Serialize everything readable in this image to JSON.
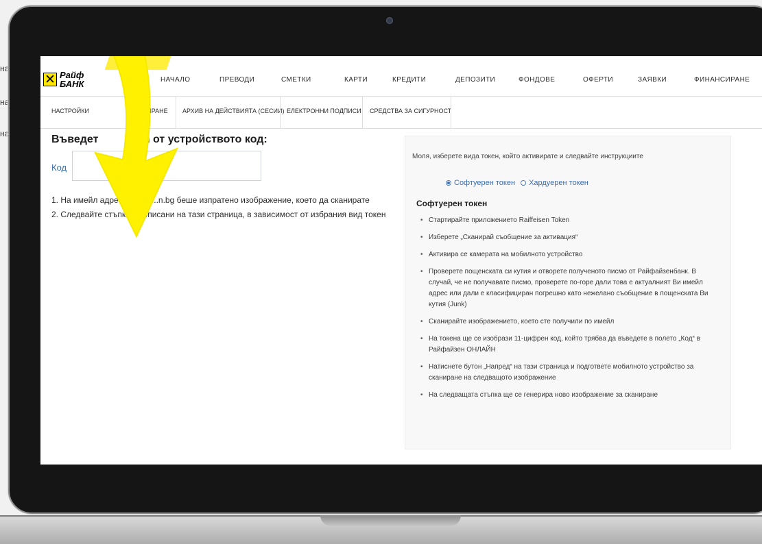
{
  "brand": {
    "line1": "Райф",
    "line2": "БАНК"
  },
  "left_strip": [
    "на",
    "на",
    "на"
  ],
  "nav": {
    "items": [
      "НАЧАЛО",
      "ПРЕВОДИ",
      "СМЕТКИ",
      "КАРТИ",
      "КРЕДИТИ",
      "ДЕПОЗИТИ",
      "ФОНДОВЕ",
      "ОФЕРТИ",
      "ЗАЯВКИ",
      "ФИНАНСИРАНЕ"
    ]
  },
  "subnav": {
    "items": [
      "НАСТРОЙКИ",
      "КИРАНЕ",
      "АРХИВ НА ДЕЙСТВИЯТА (СЕСИИ)",
      "ЕЛЕКТРОННИ ПОДПИСИ",
      "СРЕДСТВА ЗА СИГУРНОСТ"
    ]
  },
  "page": {
    "title_left": "Въведет",
    "title_right": "ия от устройството код:",
    "code_label": "Код",
    "code_value": "",
    "steps": [
      "1. На имейл адрес e...g@r...n.bg беше изпратено изображение, което да сканирате",
      "2. Следвайте стъпките, описани на тази страница, в зависимост от избрания вид токен"
    ]
  },
  "panel": {
    "instruction": "Моля, изберете вида токен, който активирате и следвайте инструкциите",
    "token_software": "Софтуерен токен",
    "token_hardware": "Хардуерен токен",
    "section_title": "Софтуерен токен",
    "bullets": [
      "Стартирайте приложението Raiffeisen Token",
      "Изберете „Сканирай съобщение за активация“",
      "Активира се камерата на мобилното устройство",
      "Проверете пощенската си кутия и отворете полученото писмо от Райфайзенбанк. В случай, че не получавате писмо, проверете по-горе дали това е актуалният Ви имейл адрес или дали е класифициран погрешно като нежелано съобщение в пощенската Ви кутия (Junk)",
      "Сканирайте изображението, което сте получили по имейл",
      "На токена ще се изобрази 11-цифрен код, който трябва да въведете в полето „Код“ в Райфайзен ОНЛАЙН",
      "Натиснете бутон „Напред“ на тази страница и подгответе мобилното устройство за сканиране на следващото изображение",
      "На следващата стъпка ще се генерира ново изображение за сканиране"
    ]
  },
  "colors": {
    "brand_yellow": "#ffe600",
    "arrow_yellow": "#fff100",
    "link_blue": "#3d6fb0"
  }
}
